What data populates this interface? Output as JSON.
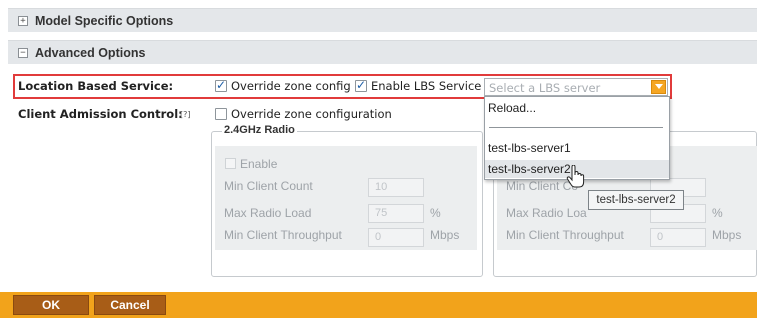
{
  "sections": {
    "model_specific": {
      "toggle": "+",
      "title": "Model Specific Options"
    },
    "advanced": {
      "toggle": "−",
      "title": "Advanced Options"
    }
  },
  "lbs": {
    "label": "Location Based Service:",
    "override_label": "Override zone config",
    "override_checked": true,
    "enable_label": "Enable LBS Service",
    "enable_checked": true,
    "select_placeholder": "Select a LBS server"
  },
  "client_admission": {
    "label": "Client Admission Control:",
    "help": "[?]",
    "override_label": "Override zone configuration",
    "override_checked": false
  },
  "radio_24": {
    "legend": "2.4GHz Radio",
    "enable_label": "Enable",
    "min_client_count_label": "Min Client Count",
    "min_client_count_value": "10",
    "max_radio_load_label": "Max Radio Load",
    "max_radio_load_value": "75",
    "max_radio_load_unit": "%",
    "min_throughput_label": "Min Client Throughput",
    "min_throughput_value": "0",
    "min_throughput_unit": "Mbps"
  },
  "radio_5": {
    "min_client_count_label": "Min Client Co",
    "max_radio_load_label": "Max Radio Loa",
    "max_radio_load_unit": "%",
    "min_throughput_label": "Min Client Throughput",
    "min_throughput_value": "0",
    "min_throughput_unit": "Mbps"
  },
  "dropdown": {
    "items": [
      "Reload...",
      "test-lbs-server1",
      "test-lbs-server2"
    ],
    "highlighted": "test-lbs-server2"
  },
  "tooltip": {
    "text": "test-lbs-server2"
  },
  "footer": {
    "ok_label": "OK",
    "cancel_label": "Cancel"
  },
  "colors": {
    "accent": "#f2a31b",
    "button": "#a85d17",
    "highlight_border": "#e13b3b"
  }
}
